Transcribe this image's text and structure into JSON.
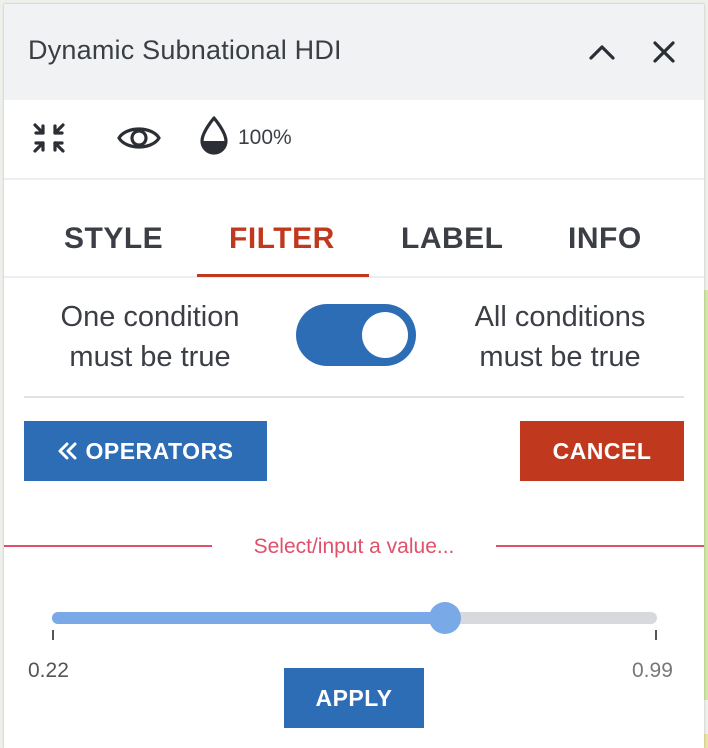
{
  "panel": {
    "title": "Dynamic Subnational HDI",
    "opacity": "100%",
    "tabs": [
      {
        "label": "STYLE",
        "active": false
      },
      {
        "label": "FILTER",
        "active": true
      },
      {
        "label": "LABEL",
        "active": false
      },
      {
        "label": "INFO",
        "active": false
      }
    ],
    "filter": {
      "one_condition": "One condition must be true",
      "all_conditions": "All conditions must be true",
      "all_conditions_selected": true,
      "operators_label": "OPERATORS",
      "cancel_label": "CANCEL",
      "hint": "Select/input a value...",
      "slider": {
        "min": 0.22,
        "max": 0.99,
        "value": 0.72,
        "min_label": "0.22",
        "max_label": "0.99"
      },
      "apply_label": "APPLY"
    }
  },
  "colors": {
    "accent_blue": "#2d6db5",
    "accent_red": "#c0391f",
    "hint_red": "#e0506a",
    "slider_fill": "#79a9e6"
  },
  "icons": [
    "chevron-up-icon",
    "close-icon",
    "shrink-icon",
    "eye-icon",
    "opacity-drop-icon",
    "double-chevron-left-icon"
  ]
}
